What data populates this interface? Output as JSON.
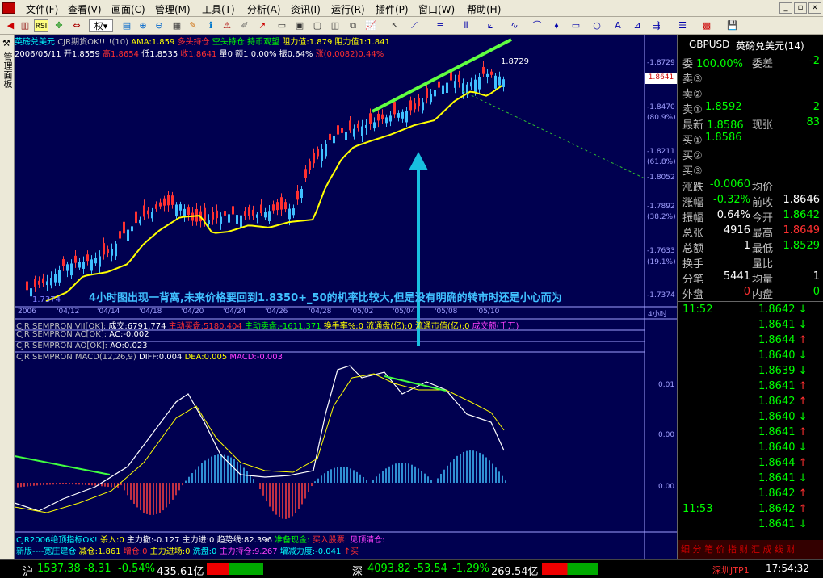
{
  "menu": [
    "文件(F)",
    "查看(V)",
    "画面(C)",
    "管理(M)",
    "工具(T)",
    "分析(A)",
    "资讯(I)",
    "运行(R)",
    "插件(P)",
    "窗口(W)",
    "帮助(H)"
  ],
  "toolbar": {
    "rights_label": "权"
  },
  "left_tab": {
    "label": "管理面板"
  },
  "chart_header": {
    "line1": {
      "name": "英磅兑美元",
      "indicator": "CJR期货OK!!!!(10)",
      "ama": "AMA:1.859",
      "duotou": "多头持仓",
      "kongtou": "空头持仓:持币观望",
      "resist1": "阻力值:1.879",
      "resist2": "阻力值1:1.841"
    },
    "line2": {
      "date": "2006/05/11",
      "open": "开1.8559",
      "high": "高1.8654",
      "low": "低1.8535",
      "close": "收1.8641",
      "vol": "量0",
      "amount": "额1",
      "change_pct": "0.00%",
      "amplitude": "振0.64%",
      "change": "涨(0.0082)0.44%"
    }
  },
  "price_axis": {
    "ticks": [
      "1.8729",
      "1.8470",
      "(80.9%)",
      "1.8211",
      "(61.8%)",
      "1.8052",
      "1.7892",
      "(38.2%)",
      "1.7633",
      "(19.1%)",
      "1.7374"
    ],
    "current_price": "1.8641",
    "high_label": "1.8729",
    "low_label": "1.7374"
  },
  "annotation": "4小时图出现一背离,未来价格要回到1.8350+_50的机率比较大,但是没有明确的转市时还是小心而为",
  "date_axis": {
    "labels": [
      "2006",
      "'04/12",
      "'04/14",
      "'04/18",
      "'04/20",
      "'04/24",
      "'04/26",
      "'04/28",
      "'05/02",
      "'05/04",
      "'05/08",
      "'05/10"
    ],
    "period": "4小时"
  },
  "indicator_rows": [
    {
      "name": "CJR SEMPRON VII[OK]:",
      "parts": [
        {
          "t": "成交:6791.774",
          "c": "white"
        },
        {
          "t": "主动买盘:5180.404",
          "c": "red"
        },
        {
          "t": "主动卖盘:-1611.371",
          "c": "green"
        },
        {
          "t": "换手率%:0",
          "c": "yellow"
        },
        {
          "t": "流通盘(亿):0",
          "c": "yellow"
        },
        {
          "t": "流通市值(亿):0",
          "c": "yellow"
        },
        {
          "t": "成交额(千万)",
          "c": "magenta"
        }
      ]
    },
    {
      "name": "CJR SEMPRON  AC[OK]:",
      "parts": [
        {
          "t": "AC:-0.002",
          "c": "white"
        }
      ]
    },
    {
      "name": "CJR SEMPRON AO[OK]:",
      "parts": [
        {
          "t": "AO:0.023",
          "c": "white"
        }
      ]
    },
    {
      "name": "CJR SEMPRON MACD(12,26,9)",
      "parts": [
        {
          "t": "DIFF:0.004",
          "c": "white"
        },
        {
          "t": "DEA:0.005",
          "c": "yellow"
        },
        {
          "t": "MACD:-0.003",
          "c": "magenta"
        }
      ]
    }
  ],
  "macd_axis": [
    "0.01",
    "0.00",
    "0.00"
  ],
  "bottom_rows": [
    {
      "parts": [
        {
          "t": "CJR2006绝顶指标OK!",
          "c": "cyan"
        },
        {
          "t": "杀入:0",
          "c": "yellow"
        },
        {
          "t": "主力撤:-0.127",
          "c": "white"
        },
        {
          "t": "主力进:0",
          "c": "white"
        },
        {
          "t": "趋势线:82.396",
          "c": "white"
        },
        {
          "t": "准备现金:",
          "c": "green"
        },
        {
          "t": "买入股票:",
          "c": "red"
        },
        {
          "t": "见顶清仓:",
          "c": "magenta"
        }
      ]
    },
    {
      "parts": [
        {
          "t": "新版----宽庄建仓",
          "c": "cyan"
        },
        {
          "t": "减仓:1.861",
          "c": "yellow"
        },
        {
          "t": "增仓:0",
          "c": "red"
        },
        {
          "t": "主力进场:0",
          "c": "yellow"
        },
        {
          "t": "洗盘:0",
          "c": "cyan"
        },
        {
          "t": "主力持仓:9.267",
          "c": "magenta"
        },
        {
          "t": "增减力度:-0.041",
          "c": "cyan"
        },
        {
          "t": "↑买",
          "c": "red"
        }
      ]
    }
  ],
  "quote": {
    "symbol": "GBPUSD",
    "name": "英磅兑美元(14)",
    "wei_label": "委",
    "wei_value": "100.00%",
    "weicha_label": "委差",
    "weicha_value": "-2",
    "sell": [
      {
        "label": "卖③",
        "price": "",
        "vol": ""
      },
      {
        "label": "卖②",
        "price": "",
        "vol": ""
      },
      {
        "label": "卖①",
        "price": "1.8592",
        "vol": "2"
      }
    ],
    "latest_label": "最新",
    "latest_value": "1.8586",
    "xianzhang_label": "现张",
    "xianzhang_value": "83",
    "buy": [
      {
        "label": "买①",
        "price": "1.8586",
        "vol": ""
      },
      {
        "label": "买②",
        "price": "",
        "vol": ""
      },
      {
        "label": "买③",
        "price": "",
        "vol": ""
      }
    ],
    "stats": [
      [
        {
          "l": "涨跌",
          "v": "-0.0060",
          "c": "green"
        },
        {
          "l": "均价",
          "v": "",
          "c": "white"
        }
      ],
      [
        {
          "l": "涨幅",
          "v": "-0.32%",
          "c": "green"
        },
        {
          "l": "前收",
          "v": "1.8646",
          "c": "white"
        }
      ],
      [
        {
          "l": "振幅",
          "v": "0.64%",
          "c": "white"
        },
        {
          "l": "今开",
          "v": "1.8642",
          "c": "green"
        }
      ],
      [
        {
          "l": "总张",
          "v": "4916",
          "c": "white"
        },
        {
          "l": "最高",
          "v": "1.8649",
          "c": "red"
        }
      ],
      [
        {
          "l": "总额",
          "v": "1",
          "c": "white"
        },
        {
          "l": "最低",
          "v": "1.8529",
          "c": "green"
        }
      ],
      [
        {
          "l": "换手",
          "v": "",
          "c": "white"
        },
        {
          "l": "量比",
          "v": "",
          "c": "white"
        }
      ],
      [
        {
          "l": "分笔",
          "v": "5441",
          "c": "white"
        },
        {
          "l": "均量",
          "v": "1",
          "c": "white"
        }
      ],
      [
        {
          "l": "外盘",
          "v": "0",
          "c": "red"
        },
        {
          "l": "内盘",
          "v": "0",
          "c": "green"
        }
      ]
    ],
    "ticks_time1": "11:52",
    "ticks1": [
      {
        "p": "1.8642",
        "a": "↓"
      },
      {
        "p": "1.8641",
        "a": "↓"
      },
      {
        "p": "1.8644",
        "a": "↑"
      },
      {
        "p": "1.8640",
        "a": "↓"
      },
      {
        "p": "1.8639",
        "a": "↓"
      },
      {
        "p": "1.8641",
        "a": "↑"
      },
      {
        "p": "1.8642",
        "a": "↑"
      },
      {
        "p": "1.8640",
        "a": "↓"
      },
      {
        "p": "1.8641",
        "a": "↑"
      },
      {
        "p": "1.8640",
        "a": "↓"
      },
      {
        "p": "1.8644",
        "a": "↑"
      },
      {
        "p": "1.8641",
        "a": "↓"
      },
      {
        "p": "1.8642",
        "a": "↑"
      }
    ],
    "ticks_time2": "11:53",
    "ticks2": [
      {
        "p": "1.8642",
        "a": "↑"
      },
      {
        "p": "1.8641",
        "a": "↓"
      }
    ],
    "bottom_tabs": "细 分 笔 价 指 财 汇 成 线 财"
  },
  "statusbar": {
    "sh_label": "沪",
    "sh_index": "1537.38",
    "sh_change": "-8.31",
    "sh_pct": "-0.54%",
    "sh_amount": "435.61亿",
    "sz_label": "深",
    "sz_index": "4093.82",
    "sz_change": "-53.54",
    "sz_pct": "-1.29%",
    "sz_amount": "269.54亿",
    "server": "深圳JTP1",
    "time": "17:54:32"
  }
}
